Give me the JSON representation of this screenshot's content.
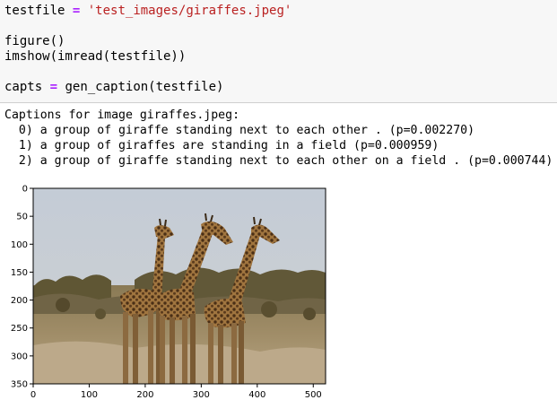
{
  "code": {
    "line1": {
      "var": "testfile",
      "op": "=",
      "str": "'test_images/giraffes.jpeg'"
    },
    "line2": "figure()",
    "line3": "imshow(imread(testfile))",
    "line4": {
      "var": "capts",
      "op": "=",
      "call": "gen_caption(testfile)"
    }
  },
  "output": {
    "header": "Captions for image giraffes.jpeg:",
    "captions": [
      "  0) a group of giraffe standing next to each other . (p=0.002270)",
      "  1) a group of giraffes are standing in a field (p=0.000959)",
      "  2) a group of giraffe standing next to each other on a field . (p=0.000744)"
    ]
  },
  "plot": {
    "x_ticks": [
      "0",
      "100",
      "200",
      "300",
      "400",
      "500"
    ],
    "y_ticks": [
      "0",
      "50",
      "100",
      "150",
      "200",
      "250",
      "300",
      "350"
    ],
    "xlim": [
      0,
      522
    ],
    "ylim": [
      0,
      350
    ]
  }
}
